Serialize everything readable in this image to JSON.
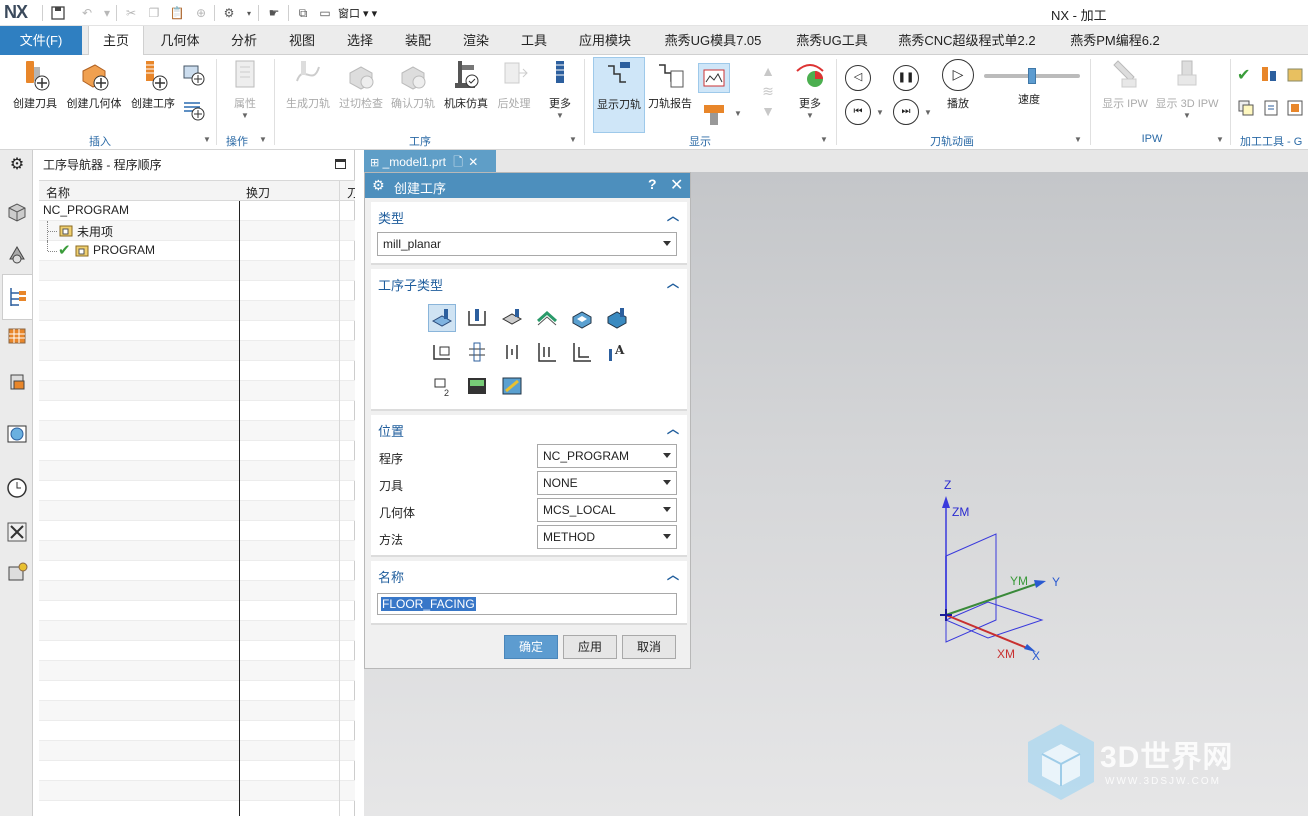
{
  "app": {
    "logo": "NX",
    "title": "NX - 加工",
    "window_menu": "窗口"
  },
  "menu": {
    "file": "文件(F)",
    "tabs": [
      "主页",
      "几何体",
      "分析",
      "视图",
      "选择",
      "装配",
      "渲染",
      "工具",
      "应用模块",
      "燕秀UG模具7.05",
      "燕秀UG工具",
      "燕秀CNC超级程式单2.2",
      "燕秀PM编程6.2"
    ]
  },
  "ribbon": {
    "create_tool": "创建刀具",
    "create_geometry": "创建几何体",
    "create_operation": "创建工序",
    "insert_group": "插入",
    "properties": "属性",
    "operation_group": "操作",
    "generate_path": "生成刀轨",
    "gouge_check": "过切检查",
    "verify_path": "确认刀轨",
    "machine_sim": "机床仿真",
    "postprocess": "后处理",
    "more1": "更多",
    "procedure_group": "工序",
    "show_path": "显示刀轨",
    "path_report": "刀轨报告",
    "more2": "更多",
    "display_group": "显示",
    "play": "播放",
    "speed": "速度",
    "speed_level": 0.5,
    "animation_group": "刀轨动画",
    "show_ipw": "显示 IPW",
    "show_3d_ipw": "显示 3D IPW",
    "ipw_group": "IPW",
    "machining_tools_group": "加工工具 - G"
  },
  "navigator": {
    "title": "工序导航器 - 程序顺序",
    "columns": [
      "名称",
      "换刀",
      "刀"
    ],
    "rows": [
      {
        "name": "NC_PROGRAM"
      },
      {
        "name": "未用项"
      },
      {
        "name": "PROGRAM"
      }
    ]
  },
  "doc_tab": {
    "name": "_model1.prt"
  },
  "dialog": {
    "title": "创建工序",
    "help": "?",
    "type_section": "类型",
    "type_value": "mill_planar",
    "subtype_section": "工序子类型",
    "location_section": "位置",
    "program_label": "程序",
    "program_value": "NC_PROGRAM",
    "tool_label": "刀具",
    "tool_value": "NONE",
    "geometry_label": "几何体",
    "geometry_value": "MCS_LOCAL",
    "method_label": "方法",
    "method_value": "METHOD",
    "name_section": "名称",
    "name_value": "FLOOR_FACING",
    "ok": "确定",
    "apply": "应用",
    "cancel": "取消"
  },
  "axes": {
    "z": "Z",
    "zm": "ZM",
    "y": "Y",
    "ym": "YM",
    "x": "X",
    "xm": "XM"
  },
  "watermark": {
    "text": "3D世界网",
    "sub": "WWW.3DSJW.COM"
  },
  "colors": {
    "file_tab": "#2f7fc1",
    "dialog_title": "#4d8fbd",
    "section_title": "#1f5d9c",
    "ok_button": "#5d9cd0"
  }
}
